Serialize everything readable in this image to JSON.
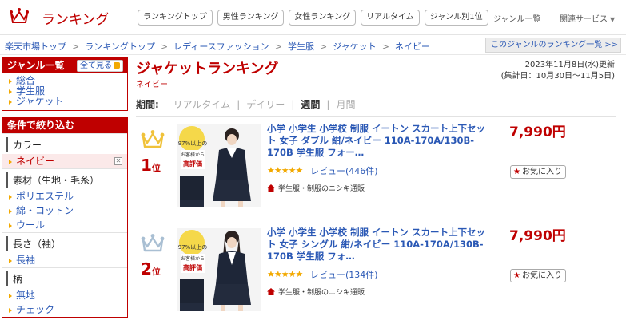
{
  "header": {
    "logo_text": "ランキング",
    "nav": [
      "ランキングトップ",
      "男性ランキング",
      "女性ランキング",
      "リアルタイム",
      "ジャンル別1位"
    ],
    "genre_list_label": "ジャンル一覧",
    "related_services_label": "関連サービス"
  },
  "breadcrumb": [
    "楽天市場トップ",
    "ランキングトップ",
    "レディースファッション",
    "学生服",
    "ジャケット",
    "ネイビー"
  ],
  "genre_ranking_button": "このジャンルのランキング一覧 >>",
  "sidebar": {
    "genre_box": {
      "title": "ジャンル一覧",
      "see_all": "全て見る",
      "items": [
        "総合",
        "学生服",
        "ジャケット"
      ]
    },
    "filter": {
      "title": "条件で絞り込む",
      "sections": [
        {
          "title": "カラー",
          "items": [
            {
              "label": "ネイビー",
              "selected": true
            }
          ]
        },
        {
          "title": "素材（生地・毛糸）",
          "items": [
            {
              "label": "ポリエステル"
            },
            {
              "label": "綿・コットン"
            },
            {
              "label": "ウール"
            }
          ]
        },
        {
          "title": "長さ（袖）",
          "items": [
            {
              "label": "長袖"
            }
          ]
        },
        {
          "title": "柄",
          "items": [
            {
              "label": "無地"
            },
            {
              "label": "チェック"
            }
          ]
        }
      ]
    }
  },
  "main": {
    "title": "ジャケットランキング",
    "subtitle": "ネイビー",
    "updated": "2023年11月8日(水)更新",
    "period_range": "(集計日：10月30日〜11月5日)",
    "period": {
      "label": "期間:",
      "options": [
        "リアルタイム",
        "デイリー",
        "週間",
        "月間"
      ],
      "selected": "週間"
    },
    "items": [
      {
        "rank": "1",
        "rank_suffix": "位",
        "crown_color": "#f0c23a",
        "name": "小学 小学生 小学校 制服 イートン スカート上下セット 女子 ダブル 紺/ネイビー 110A-170A/130B-170B 学生服 フォー…",
        "stars": "★★★★★",
        "rating": 4.5,
        "reviews": "レビュー(446件)",
        "shop": "学生服・制服のニシキ通販",
        "price": "7,990円",
        "fav": "お気に入り",
        "badge_top": "97%以上の",
        "badge_mid": "お客様から",
        "badge_big": "高評価"
      },
      {
        "rank": "2",
        "rank_suffix": "位",
        "crown_color": "#a9bfd3",
        "name": "小学 小学生 小学校 制服 イートン スカート上下セット 女子 シングル 紺/ネイビー 110A-170A/130B-170B 学生服 フォ…",
        "stars": "★★★★★",
        "rating": 4.5,
        "reviews": "レビュー(134件)",
        "shop": "学生服・制服のニシキ通販",
        "price": "7,990円",
        "fav": "お気に入り",
        "badge_top": "97%以上の",
        "badge_mid": "お客様から",
        "badge_big": "高評価"
      }
    ]
  },
  "colors": {
    "accent": "#bf0000",
    "link": "#2a58b5",
    "star": "#f2a900"
  }
}
